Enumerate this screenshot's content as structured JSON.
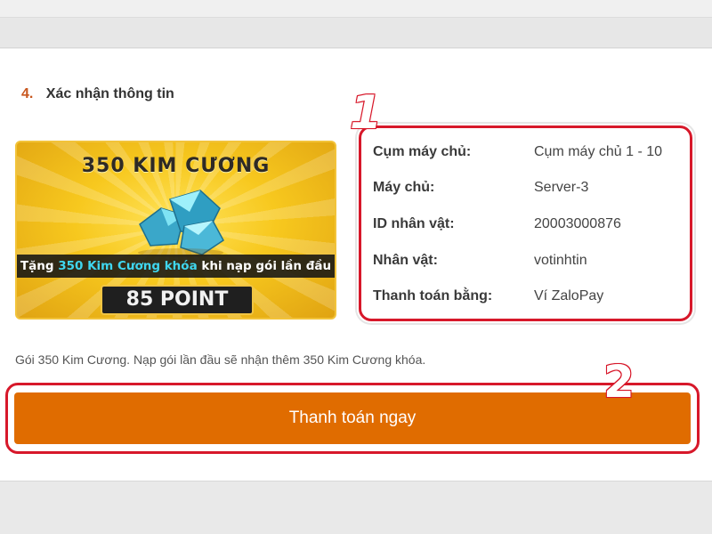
{
  "step": {
    "number": "4.",
    "title": "Xác nhận thông tin"
  },
  "banner": {
    "title": "350 KIM CƯƠNG",
    "promo_prefix": "Tặng ",
    "promo_highlight": "350 Kim Cương khóa",
    "promo_suffix": " khi nạp gói lần đầu",
    "points": "85 POINT",
    "icon": "diamond-pile-icon"
  },
  "info": {
    "rows": [
      {
        "label": "Cụm máy chủ:",
        "value": "Cụm máy chủ 1 - 10"
      },
      {
        "label": "Máy chủ:",
        "value": "Server-3"
      },
      {
        "label": "ID nhân vật:",
        "value": "20003000876"
      },
      {
        "label": "Nhân vật:",
        "value": "votinhtin"
      },
      {
        "label": "Thanh toán bằng:",
        "value": "Ví ZaloPay"
      }
    ]
  },
  "annotations": {
    "badge_1": "1",
    "badge_2": "2"
  },
  "description": "Gói 350 Kim Cương. Nạp gói lần đầu sẽ nhận thêm 350 Kim Cương khóa.",
  "pay_button": {
    "label": "Thanh toán ngay"
  },
  "colors": {
    "accent_orange": "#e06c00",
    "step_number": "#c8571e",
    "annotation_red": "#d7182a",
    "gem_blue": "#3fd6ef"
  }
}
